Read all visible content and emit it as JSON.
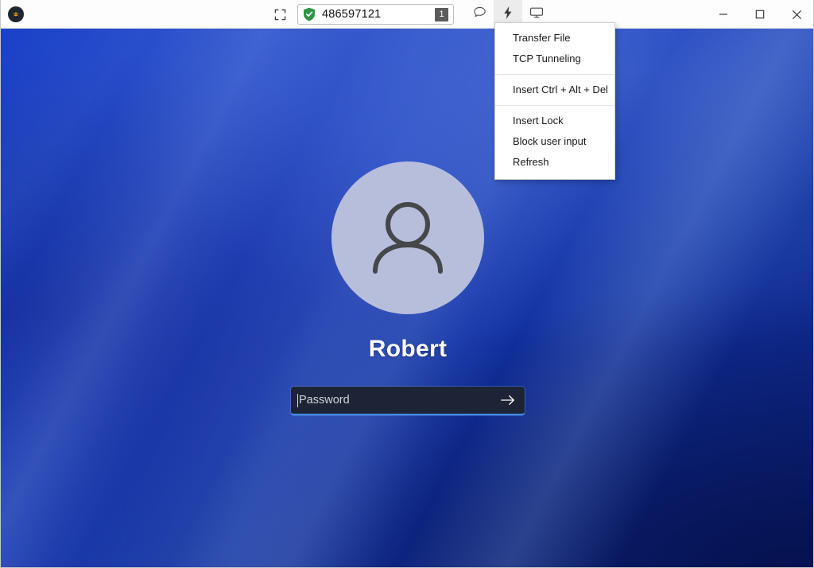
{
  "window": {
    "app_logo_icon": "anydesk-logo-icon",
    "fullscreen_icon": "fullscreen-icon",
    "controls": {
      "minimize_label": "–",
      "minimize_icon": "minimize-icon",
      "maximize_icon": "maximize-icon",
      "close_icon": "close-icon"
    }
  },
  "address_bar": {
    "security_icon": "green-shield-check-icon",
    "session_id": "486597121",
    "session_count_badge": "1"
  },
  "tool_tabs": [
    {
      "name": "chat",
      "icon": "chat-bubble-icon",
      "active": false
    },
    {
      "name": "actions",
      "icon": "lightning-bolt-icon",
      "active": true
    },
    {
      "name": "display",
      "icon": "monitor-icon",
      "active": false
    }
  ],
  "tools_menu": {
    "open": true,
    "items": [
      {
        "label": "Transfer File",
        "type": "item"
      },
      {
        "label": "TCP Tunneling",
        "type": "item"
      },
      {
        "label": "",
        "type": "separator"
      },
      {
        "label": "Insert Ctrl + Alt + Del",
        "type": "item"
      },
      {
        "label": "",
        "type": "separator"
      },
      {
        "label": "Insert Lock",
        "type": "item"
      },
      {
        "label": "Block user input",
        "type": "item"
      },
      {
        "label": "Refresh",
        "type": "item"
      }
    ]
  },
  "remote_desktop": {
    "lock_screen": {
      "avatar_icon": "user-avatar-icon",
      "username": "Robert",
      "password_placeholder": "Password",
      "password_value": "",
      "submit_icon": "arrow-right-icon"
    }
  },
  "colors": {
    "accent_blue": "#1940c8",
    "wallpaper_deep": "#0b2176",
    "avatar_fill": "#b6bedc",
    "shield_green": "#2e9547",
    "active_tab_bg": "#ececec",
    "password_field_bg": "#1c2435",
    "password_underline": "#3f8ce8",
    "badge_bg": "#5c5c5c"
  }
}
